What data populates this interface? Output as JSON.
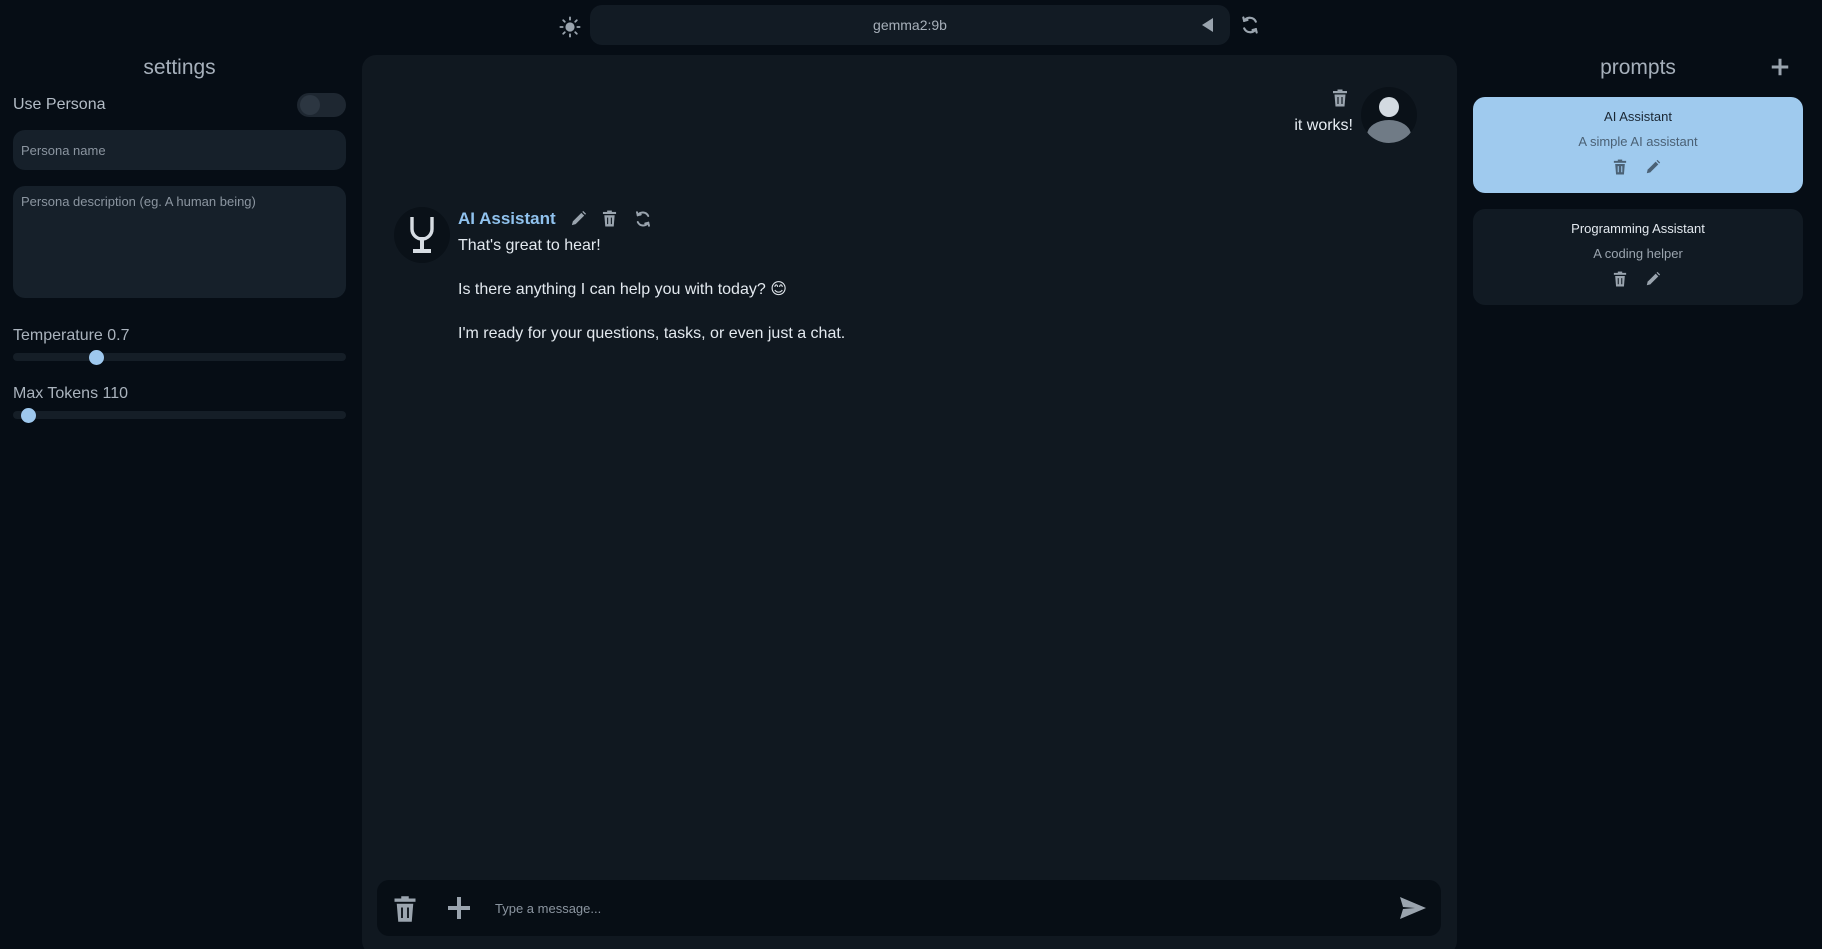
{
  "header": {
    "model_name": "gemma2:9b",
    "theme_icon": "sun-icon",
    "caret_icon": "caret-left-icon",
    "refresh_icon": "refresh-icon"
  },
  "settings": {
    "title": "settings",
    "use_persona_label": "Use Persona",
    "use_persona_enabled": false,
    "persona_name_placeholder": "Persona name",
    "persona_description_placeholder": "Persona description (eg. A human being)",
    "temperature_label": "Temperature 0.7",
    "temperature_value": 0.7,
    "temperature_fraction": 0.25,
    "max_tokens_label": "Max Tokens 110",
    "max_tokens_value": 110,
    "max_tokens_fraction": 0.045
  },
  "chat": {
    "user_message": "it works!",
    "assistant_name": "AI Assistant",
    "assistant_paragraphs": [
      "That's great to hear!",
      "Is there anything I can help you with today? 😊",
      "I'm ready for your questions, tasks, or even just a chat."
    ],
    "input_placeholder": "Type a message..."
  },
  "prompts": {
    "title": "prompts",
    "items": [
      {
        "title": "AI Assistant",
        "description": "A simple AI assistant",
        "active": true
      },
      {
        "title": "Programming Assistant",
        "description": "A coding helper",
        "active": false
      }
    ]
  },
  "colors": {
    "background": "#060d15",
    "panel": "#101820",
    "accent": "#9fcaee",
    "assistant_name": "#90c2ee"
  }
}
